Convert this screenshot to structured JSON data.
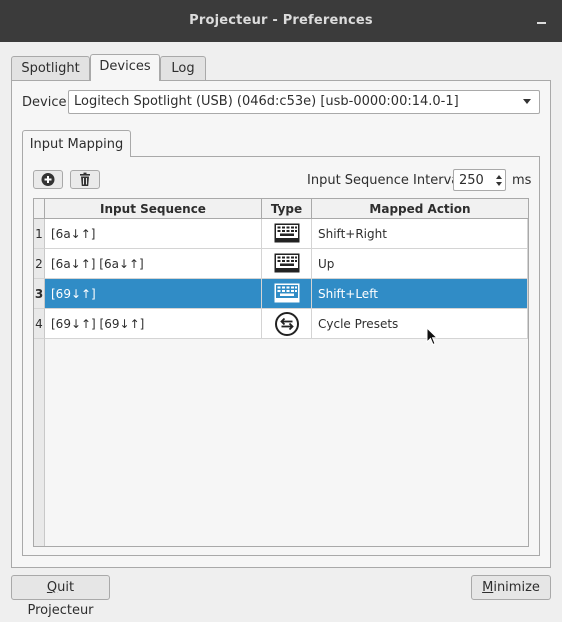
{
  "window": {
    "title": "Projecteur - Preferences"
  },
  "tabs": [
    {
      "label": "Spotlight"
    },
    {
      "label": "Devices"
    },
    {
      "label": "Log"
    }
  ],
  "device": {
    "label": "Device",
    "selected": "Logitech Spotlight (USB) (046d:c53e) [usb-0000:00:14.0-1]"
  },
  "input_mapping": {
    "tab_label": "Input Mapping",
    "toolbar": {
      "add_icon": "plus-circle-icon",
      "delete_icon": "trash-icon"
    },
    "interval": {
      "label": "Input Sequence Interval",
      "value": "250",
      "unit": "ms"
    },
    "table": {
      "columns": [
        "Input Sequence",
        "Type",
        "Mapped Action"
      ],
      "rows": [
        {
          "num": "1",
          "sequence": "[6a↓↑]",
          "type_icon": "keyboard-icon",
          "action": "Shift+Right",
          "selected": false
        },
        {
          "num": "2",
          "sequence": "[6a↓↑]  [6a↓↑]",
          "type_icon": "keyboard-icon",
          "action": "Up",
          "selected": false
        },
        {
          "num": "3",
          "sequence": "[69↓↑]",
          "type_icon": "keyboard-icon",
          "action": "Shift+Left",
          "selected": true
        },
        {
          "num": "4",
          "sequence": "[69↓↑]  [69↓↑]",
          "type_icon": "cycle-arrows-icon",
          "action": "Cycle Presets",
          "selected": false
        }
      ]
    }
  },
  "buttons": {
    "quit": {
      "mnemonic": "Q",
      "rest": "uit Projecteur"
    },
    "minimize": {
      "mnemonic": "M",
      "rest": "inimize"
    }
  },
  "colors": {
    "selection": "#308cc6",
    "titlebar": "#3b3b3b"
  }
}
